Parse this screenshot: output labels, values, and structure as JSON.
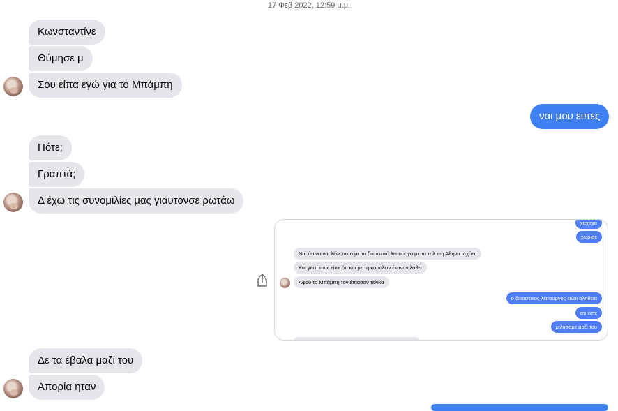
{
  "timestamp": "17 Φεβ 2022, 12:59 μ.μ.",
  "group1": [
    "Κωνσταντίνε",
    "Θύμησε μ",
    "Σου είπα εγώ για το Μπάμπη"
  ],
  "reply1": "ναι μου ειπες",
  "group2": [
    "Πότε;",
    "Γραπτά;",
    "Δ έχω τις συνομιλίες μας γιαυτονσε ρωτάω"
  ],
  "shared_image": {
    "out_top": [
      "χαχαχα",
      "χωρισε"
    ],
    "incoming": [
      "Ναι ότι να ναι λένε.αυτο με το δικαστικό λειτουργο με τα τηλ ετη Αθηνα ισχύει;",
      "Και γιατί τους είπε ότι και με τη καρολειν έκαναν λαθει",
      "Αφού το Μπάμπη τον έπιασαν τελικα"
    ],
    "out_bottom": [
      "ο δικαστικος λειτουργος ειναι αληθεια",
      "οτι ειπε",
      "μιλησαμε μαζι του"
    ]
  },
  "share_icon": "share-icon",
  "group3": [
    "Δε τα έβαλα μαζί του",
    "Απορία ηταν"
  ],
  "colors": {
    "incoming": "#e4e6eb",
    "outgoing": "#4080f5"
  }
}
